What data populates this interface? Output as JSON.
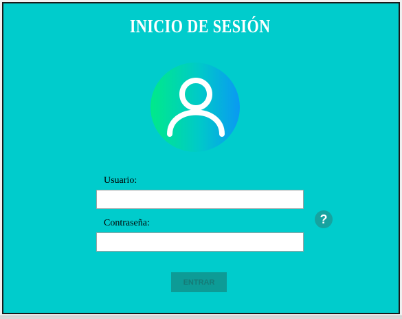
{
  "title": "INICIO DE SESIÓN",
  "form": {
    "user_label": "Usuario:",
    "user_value": "",
    "password_label": "Contraseña:",
    "password_value": "",
    "submit_label": "ENTRAR",
    "help_symbol": "?"
  },
  "colors": {
    "background": "#00cccc",
    "avatar_gradient_start": "#00e98a",
    "avatar_gradient_end": "#0a99f2",
    "button": "#0d9b96",
    "help": "#16a3a0"
  },
  "icons": {
    "avatar": "user-avatar-icon",
    "help": "help-icon"
  }
}
